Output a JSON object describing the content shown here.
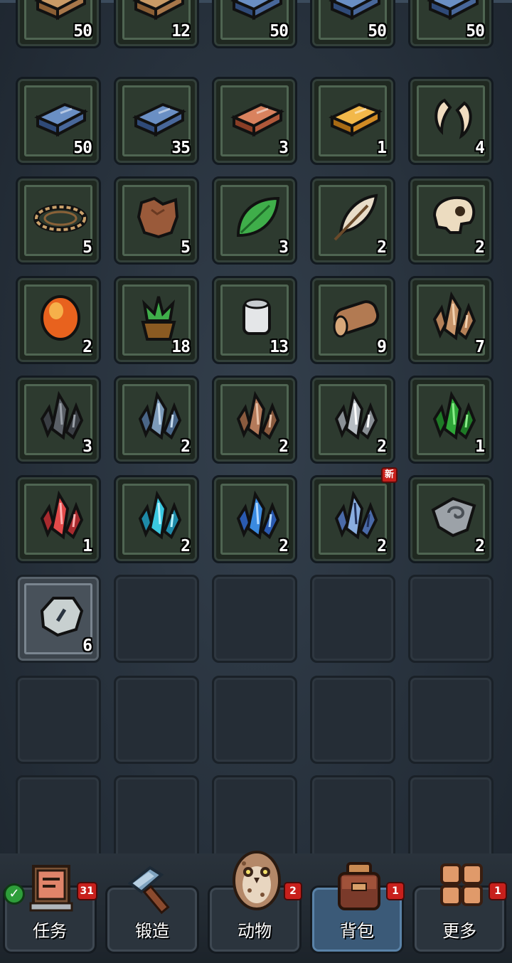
{
  "inventory": {
    "rows": [
      [
        {
          "item": "wood-plank",
          "count": "50"
        },
        {
          "item": "wood-plank",
          "count": "12"
        },
        {
          "item": "iron-ingot",
          "count": "50"
        },
        {
          "item": "iron-ingot",
          "count": "50"
        },
        {
          "item": "iron-ingot",
          "count": "50"
        }
      ],
      [
        {
          "item": "iron-ingot",
          "count": "50"
        },
        {
          "item": "iron-ingot",
          "count": "35"
        },
        {
          "item": "copper-ingot",
          "count": "3"
        },
        {
          "item": "gold-ingot",
          "count": "1"
        },
        {
          "item": "fang",
          "count": "4"
        }
      ],
      [
        {
          "item": "rope-coil",
          "count": "5"
        },
        {
          "item": "leather-hide",
          "count": "5"
        },
        {
          "item": "green-leaf",
          "count": "3"
        },
        {
          "item": "feather",
          "count": "2"
        },
        {
          "item": "skull",
          "count": "2"
        }
      ],
      [
        {
          "item": "amber-gem",
          "count": "2"
        },
        {
          "item": "potted-plant",
          "count": "18"
        },
        {
          "item": "thread-spool",
          "count": "13"
        },
        {
          "item": "log",
          "count": "9"
        },
        {
          "item": "tan-crystal",
          "count": "7"
        }
      ],
      [
        {
          "item": "dark-crystal",
          "count": "3"
        },
        {
          "item": "blue-gray-crystal",
          "count": "2"
        },
        {
          "item": "brown-crystal",
          "count": "2"
        },
        {
          "item": "silver-crystal",
          "count": "2"
        },
        {
          "item": "green-crystal",
          "count": "1"
        }
      ],
      [
        {
          "item": "red-crystal",
          "count": "1"
        },
        {
          "item": "cyan-crystal",
          "count": "2"
        },
        {
          "item": "blue-crystal",
          "count": "2"
        },
        {
          "item": "rune-crystal",
          "count": "2",
          "new": "新"
        },
        {
          "item": "stone-rune",
          "count": "2"
        }
      ],
      [
        {
          "item": "gray-stone",
          "count": "6",
          "special": true
        },
        null,
        null,
        null,
        null
      ],
      [
        null,
        null,
        null,
        null,
        null
      ],
      [
        null,
        null,
        null,
        null,
        null
      ]
    ]
  },
  "bottom_nav": {
    "tasks": {
      "label": "任务",
      "badge": "31",
      "icon": "task-board-icon"
    },
    "forge": {
      "label": "锻造",
      "icon": "hammer-icon"
    },
    "animals": {
      "label": "动物",
      "badge": "2",
      "icon": "owl-icon"
    },
    "backpack": {
      "label": "背包",
      "badge": "1",
      "icon": "backpack-icon",
      "active": true
    },
    "more": {
      "label": "更多",
      "badge": "1",
      "icon": "grid-icon"
    }
  },
  "colors": {
    "active_tab": "#3b5a78",
    "badge_red": "#c8201c",
    "slot_green": "#2d3a2f"
  }
}
